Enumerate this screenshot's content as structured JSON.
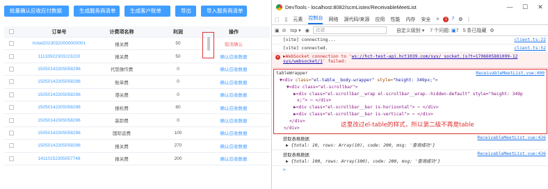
{
  "toolbar": {
    "buttons": [
      "批量确认应收应付数据",
      "生成服务商清单",
      "生成客户账单",
      "导出",
      "导入服务商清单"
    ]
  },
  "table": {
    "headers": [
      "订单号",
      "计费项名称",
      "利润",
      "操作"
    ],
    "rows": [
      {
        "order": "hctwl20230320000000001",
        "fee": "报关费",
        "profit": "50",
        "action": "取消确认"
      },
      {
        "order": "11133922303223220",
        "fee": "报关费",
        "profit": "50",
        "action": "确认应收数据"
      },
      {
        "order": "15050142305058296",
        "fee": "代垫操作费",
        "profit": "0",
        "action": "确认应收数据"
      },
      {
        "order": "15050142305058296",
        "fee": "账单费",
        "profit": "0",
        "action": "确认应收数据"
      },
      {
        "order": "15050142305058296",
        "fee": "港关费",
        "profit": "0",
        "action": "确认应收数据"
      },
      {
        "order": "15050142305058296",
        "fee": "报检费",
        "profit": "80",
        "action": "确认应收数据"
      },
      {
        "order": "15050142305058296",
        "fee": "装卸费",
        "profit": "0",
        "action": "确认应收数据"
      },
      {
        "order": "15050142305058296",
        "fee": "国际运费",
        "profit": "100",
        "action": "确认应收数据"
      },
      {
        "order": "15050142305058296",
        "fee": "报关费",
        "profit": "270",
        "action": "确认应收数据"
      },
      {
        "order": "14110152305057748",
        "fee": "报关费",
        "profit": "200",
        "action": "确认应收数据"
      }
    ]
  },
  "devtools": {
    "title": "DevTools - localhost:8082/scmListex/ReceivableMeetList",
    "tabs": [
      "元素",
      "控制台",
      "网络",
      "源代码/来源",
      "应用",
      "性能",
      "内存",
      "安全"
    ],
    "active_tab": "控制台",
    "error_count": "1",
    "msg_count": "7",
    "filter": {
      "top_label": "top",
      "placeholder": "过滤",
      "level": "自定义级别",
      "issues": "7 个问题:",
      "issues_count": "7",
      "hidden": "5 条已隐藏"
    },
    "console": [
      {
        "text": "[vite] connecting...",
        "src": "client.ts:22"
      },
      {
        "text": "[vite] connected.",
        "src": "client.ts:52"
      },
      {
        "text_pre": "▶WebSocket connection to '",
        "url": "ws://hct-test-api.hct1039.com/sys/ socket.js?t=1706605881099-12 sys/websocket/1",
        "text_post": "' failed:",
        "src": "socket.js?t=1706605881099:12",
        "type": "error"
      }
    ],
    "wrapper": {
      "label": "tableWrapper",
      "src": "ReceivableMeetList.vue:400",
      "l1_tag": "▼<div",
      "l1_attr": "class=",
      "l1_val": "\"el-table__body-wrapper\"",
      "l1_attr2": "style=",
      "l1_val2": "\"height: 349px;\"",
      "l1_end": ">",
      "l2": "▼<div class=\"el-scrollbar\">",
      "l3": "▶<div class=\"el-scrollbar__wrap el-scrollbar__wrap--hidden-default\" style=\"height: 349p",
      "l3b": "x;\"> ⋯ </div>",
      "l4": "▶<div class=\"el-scrollbar__bar is-horizontal\"> ⋯ </div>",
      "l5": "▶<div class=\"el-scrollbar__bar is-vertical\"> ⋯ </div>",
      "l6": "</div>",
      "l7": "</div>",
      "annotation": "这里改过el-table的样式，所以第二级不再是table"
    },
    "logs": [
      {
        "label": "获取表格数据",
        "src": "ReceivableMeetList.vue:436",
        "obj": "▶ {total: 10, rows: Array(10), code: 200, msg: '查询成功'}"
      },
      {
        "label": "获取表格数据",
        "src": "ReceivableMeetList.vue:436",
        "obj": "▶ {total: 100, rows: Array(100), code: 200, msg: '查询成功'}"
      }
    ],
    "prompt": ">"
  }
}
